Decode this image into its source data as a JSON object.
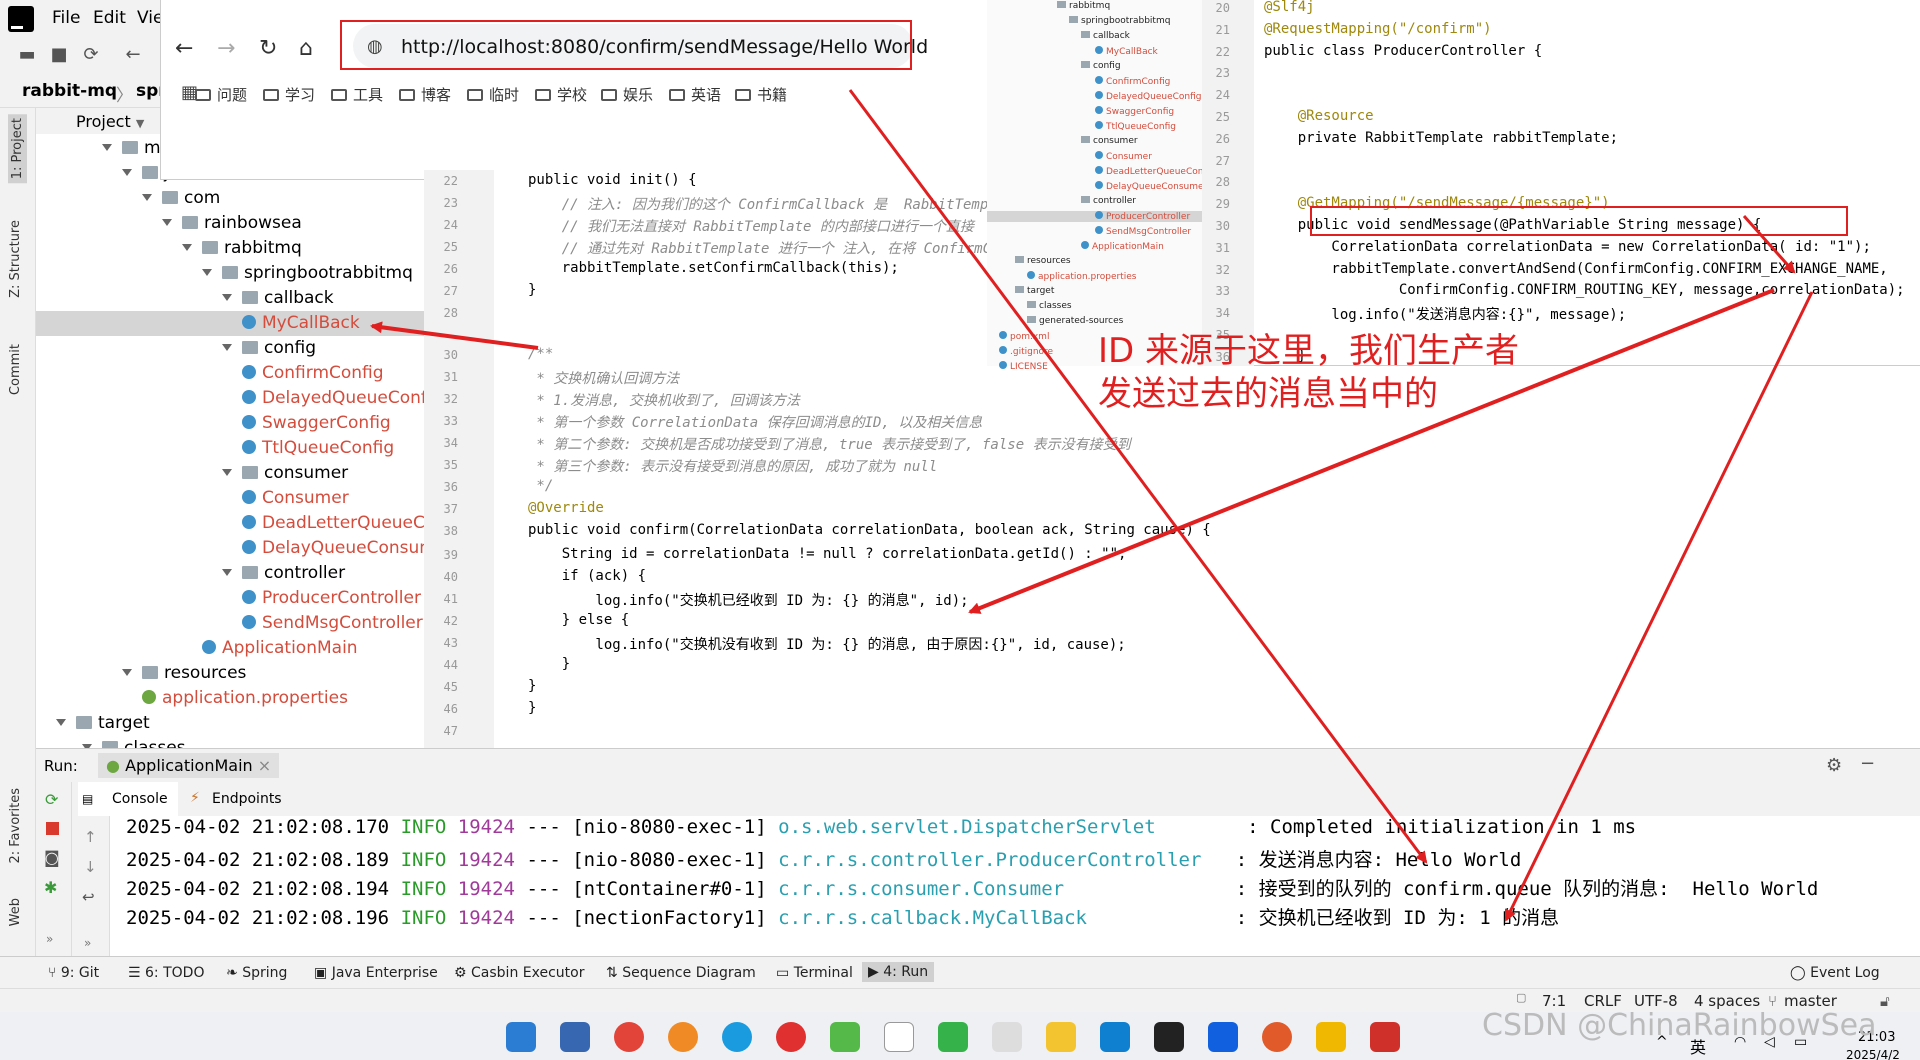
{
  "menu": {
    "file": "File",
    "edit": "Edit",
    "view": "Vie"
  },
  "nav": {
    "project": "rabbit-mq",
    "sep": "〉",
    "module": "sprin"
  },
  "left_tabs": {
    "project": "1: Project",
    "structure": "Z: Structure",
    "commit": "Commit",
    "favorites": "2: Favorites",
    "web": "Web"
  },
  "project_header": "Project",
  "tree": [
    {
      "label": "main",
      "kind": "folder"
    },
    {
      "label": "java",
      "kind": "folder"
    },
    {
      "label": "com",
      "kind": "folder"
    },
    {
      "label": "rainbowsea",
      "kind": "folder"
    },
    {
      "label": "rabbitmq",
      "kind": "folder"
    },
    {
      "label": "springbootrabbitmq",
      "kind": "folder"
    },
    {
      "label": "callback",
      "kind": "folder"
    },
    {
      "label": "MyCallBack",
      "kind": "class"
    },
    {
      "label": "config",
      "kind": "folder"
    },
    {
      "label": "ConfirmConfig",
      "kind": "class"
    },
    {
      "label": "DelayedQueueConfig",
      "kind": "class"
    },
    {
      "label": "SwaggerConfig",
      "kind": "class"
    },
    {
      "label": "TtlQueueConfig",
      "kind": "class"
    },
    {
      "label": "consumer",
      "kind": "folder"
    },
    {
      "label": "Consumer",
      "kind": "class"
    },
    {
      "label": "DeadLetterQueueCon",
      "kind": "class"
    },
    {
      "label": "DelayQueueConsumer",
      "kind": "class"
    },
    {
      "label": "controller",
      "kind": "folder"
    },
    {
      "label": "ProducerController",
      "kind": "class"
    },
    {
      "label": "SendMsgController",
      "kind": "class"
    },
    {
      "label": "ApplicationMain",
      "kind": "class"
    },
    {
      "label": "resources",
      "kind": "folder"
    },
    {
      "label": "application.properties",
      "kind": "leaf"
    },
    {
      "label": "target",
      "kind": "folder"
    },
    {
      "label": "classes",
      "kind": "folder"
    }
  ],
  "browser": {
    "url": "http://localhost:8080/confirm/sendMessage/Hello World",
    "bookmarks": [
      "问题",
      "学习",
      "工具",
      "博客",
      "临时",
      "学校",
      "娱乐",
      "英语",
      "书籍"
    ]
  },
  "editor": {
    "lines": [
      {
        "n": "22",
        "text": "public void init() {"
      },
      {
        "n": "23",
        "text": "    // 注入: 因为我们的这个 ConfirmCallback 是  RabbitTemp"
      },
      {
        "n": "24",
        "text": "    // 我们无法直接对 RabbitTemplate 的内部接口进行一个直接"
      },
      {
        "n": "25",
        "text": "    // 通过先对 RabbitTemplate 进行一个 注入, 在将 ConfirmC"
      },
      {
        "n": "26",
        "text": "    rabbitTemplate.setConfirmCallback(this);"
      },
      {
        "n": "27",
        "text": "}"
      },
      {
        "n": "28",
        "text": ""
      },
      {
        "n": "30",
        "text": "/**"
      },
      {
        "n": "31",
        "text": " * 交换机确认回调方法"
      },
      {
        "n": "32",
        "text": " * 1.发消息, 交换机收到了, 回调该方法"
      },
      {
        "n": "33",
        "text": " * 第一个参数 CorrelationData 保存回调消息的ID, 以及相关信息"
      },
      {
        "n": "34",
        "text": " * 第二个参数: 交换机是否成功接受到了消息, true 表示接受到了, false 表示没有接受到"
      },
      {
        "n": "35",
        "text": " * 第三个参数: 表示没有接受到消息的原因, 成功了就为 null"
      },
      {
        "n": "36",
        "text": " */"
      },
      {
        "n": "37",
        "text": "@Override"
      },
      {
        "n": "38",
        "text": "public void confirm(CorrelationData correlationData, boolean ack, String cause) {"
      },
      {
        "n": "39",
        "text": "    String id = correlationData != null ? correlationData.getId() : \"\";"
      },
      {
        "n": "40",
        "text": "    if (ack) {"
      },
      {
        "n": "41",
        "text": "        log.info(\"交换机已经收到 ID 为: {} 的消息\", id);"
      },
      {
        "n": "42",
        "text": "    } else {"
      },
      {
        "n": "43",
        "text": "        log.info(\"交换机没有收到 ID 为: {} 的消息, 由于原因:{}\", id, cause);"
      },
      {
        "n": "44",
        "text": "    }"
      },
      {
        "n": "45",
        "text": "}"
      },
      {
        "n": "46",
        "text": "}"
      },
      {
        "n": "47",
        "text": ""
      }
    ]
  },
  "inset_tree": [
    {
      "label": "rabbitmq",
      "kind": "folder"
    },
    {
      "label": "springbootrabbitmq",
      "kind": "folder"
    },
    {
      "label": "callback",
      "kind": "folder"
    },
    {
      "label": "MyCallBack",
      "kind": "class"
    },
    {
      "label": "config",
      "kind": "folder"
    },
    {
      "label": "ConfirmConfig",
      "kind": "class"
    },
    {
      "label": "DelayedQueueConfig",
      "kind": "class"
    },
    {
      "label": "SwaggerConfig",
      "kind": "class"
    },
    {
      "label": "TtlQueueConfig",
      "kind": "class"
    },
    {
      "label": "consumer",
      "kind": "folder"
    },
    {
      "label": "Consumer",
      "kind": "class"
    },
    {
      "label": "DeadLetterQueueCon",
      "kind": "class"
    },
    {
      "label": "DelayQueueConsumer",
      "kind": "class"
    },
    {
      "label": "controller",
      "kind": "folder"
    },
    {
      "label": "ProducerController",
      "kind": "class"
    },
    {
      "label": "SendMsgController",
      "kind": "class"
    },
    {
      "label": "ApplicationMain",
      "kind": "class"
    },
    {
      "label": "resources",
      "kind": "folder"
    },
    {
      "label": "application.properties",
      "kind": "leaf"
    },
    {
      "label": "target",
      "kind": "folder"
    },
    {
      "label": "classes",
      "kind": "folder"
    },
    {
      "label": "generated-sources",
      "kind": "folder"
    },
    {
      "label": "pom.xml",
      "kind": "leaf"
    },
    {
      "label": ".gitignore",
      "kind": "leaf"
    },
    {
      "label": "LICENSE",
      "kind": "leaf"
    }
  ],
  "inset_code": {
    "lines": [
      {
        "n": "20",
        "text": "@Slf4j"
      },
      {
        "n": "21",
        "text": "@RequestMapping(\"/confirm\")"
      },
      {
        "n": "22",
        "text": "public class ProducerController {"
      },
      {
        "n": "23",
        "text": ""
      },
      {
        "n": "24",
        "text": ""
      },
      {
        "n": "25",
        "text": "    @Resource"
      },
      {
        "n": "26",
        "text": "    private RabbitTemplate rabbitTemplate;"
      },
      {
        "n": "27",
        "text": ""
      },
      {
        "n": "28",
        "text": ""
      },
      {
        "n": "29",
        "text": "    @GetMapping(\"/sendMessage/{message}\")"
      },
      {
        "n": "30",
        "text": "    public void sendMessage(@PathVariable String message) {"
      },
      {
        "n": "31",
        "text": "        CorrelationData correlationData = new CorrelationData( id: \"1\");"
      },
      {
        "n": "32",
        "text": "        rabbitTemplate.convertAndSend(ConfirmConfig.CONFIRM_EXCHANGE_NAME,"
      },
      {
        "n": "33",
        "text": "                ConfirmConfig.CONFIRM_ROUTING_KEY, message,correlationData);"
      },
      {
        "n": "34",
        "text": "        log.info(\"发送消息内容:{}\", message);"
      },
      {
        "n": "35",
        "text": ""
      },
      {
        "n": "36",
        "text": "    }"
      }
    ]
  },
  "annotation": {
    "line1": "ID 来源于这里，我们生产者",
    "line2": "发送过去的消息当中的"
  },
  "run": {
    "label": "Run:",
    "tab": "ApplicationMain",
    "console": "Console",
    "endpoints": "Endpoints"
  },
  "logs": [
    {
      "ts": "2025-04-02 21:02:08.170",
      "level": "INFO",
      "pid": "19424",
      "sep": "---",
      "thread": "[nio-8080-exec-1]",
      "logger": "o.s.web.servlet.DispatcherServlet       ",
      "msg": ": Completed initialization in 1 ms"
    },
    {
      "ts": "2025-04-02 21:02:08.189",
      "level": "INFO",
      "pid": "19424",
      "sep": "---",
      "thread": "[nio-8080-exec-1]",
      "logger": "c.r.r.s.controller.ProducerController  ",
      "msg": ": 发送消息内容: Hello World"
    },
    {
      "ts": "2025-04-02 21:02:08.194",
      "level": "INFO",
      "pid": "19424",
      "sep": "---",
      "thread": "[ntContainer#0-1]",
      "logger": "c.r.r.s.consumer.Consumer              ",
      "msg": ": 接受到的队列的 confirm.queue 队列的消息:  Hello World"
    },
    {
      "ts": "2025-04-02 21:02:08.196",
      "level": "INFO",
      "pid": "19424",
      "sep": "---",
      "thread": "[nectionFactory1]",
      "logger": "c.r.r.s.callback.MyCallBack            ",
      "msg": ": 交换机已经收到 ID 为: 1 的消息"
    }
  ],
  "tool_tabs": {
    "git": "9: Git",
    "todo": "6: TODO",
    "spring": "Spring",
    "java_ee": "Java Enterprise",
    "casbin": "Casbin Executor",
    "sequence": "Sequence Diagram",
    "terminal": "Terminal",
    "run": "4: Run",
    "event_log": "Event Log"
  },
  "status": {
    "pos": "7:1",
    "eol": "CRLF",
    "enc": "UTF-8",
    "indent": "4 spaces",
    "branch": "master"
  },
  "taskbar": {
    "time": "21:03",
    "date": "2025/4/2",
    "ime": "英"
  },
  "watermark": "CSDN @ChinaRainbowSea",
  "colors": {
    "annotation_red": "#e02020",
    "class_name": "#d44c3c",
    "log_info": "#2a9b2a",
    "log_logger": "#2a9fb0"
  }
}
